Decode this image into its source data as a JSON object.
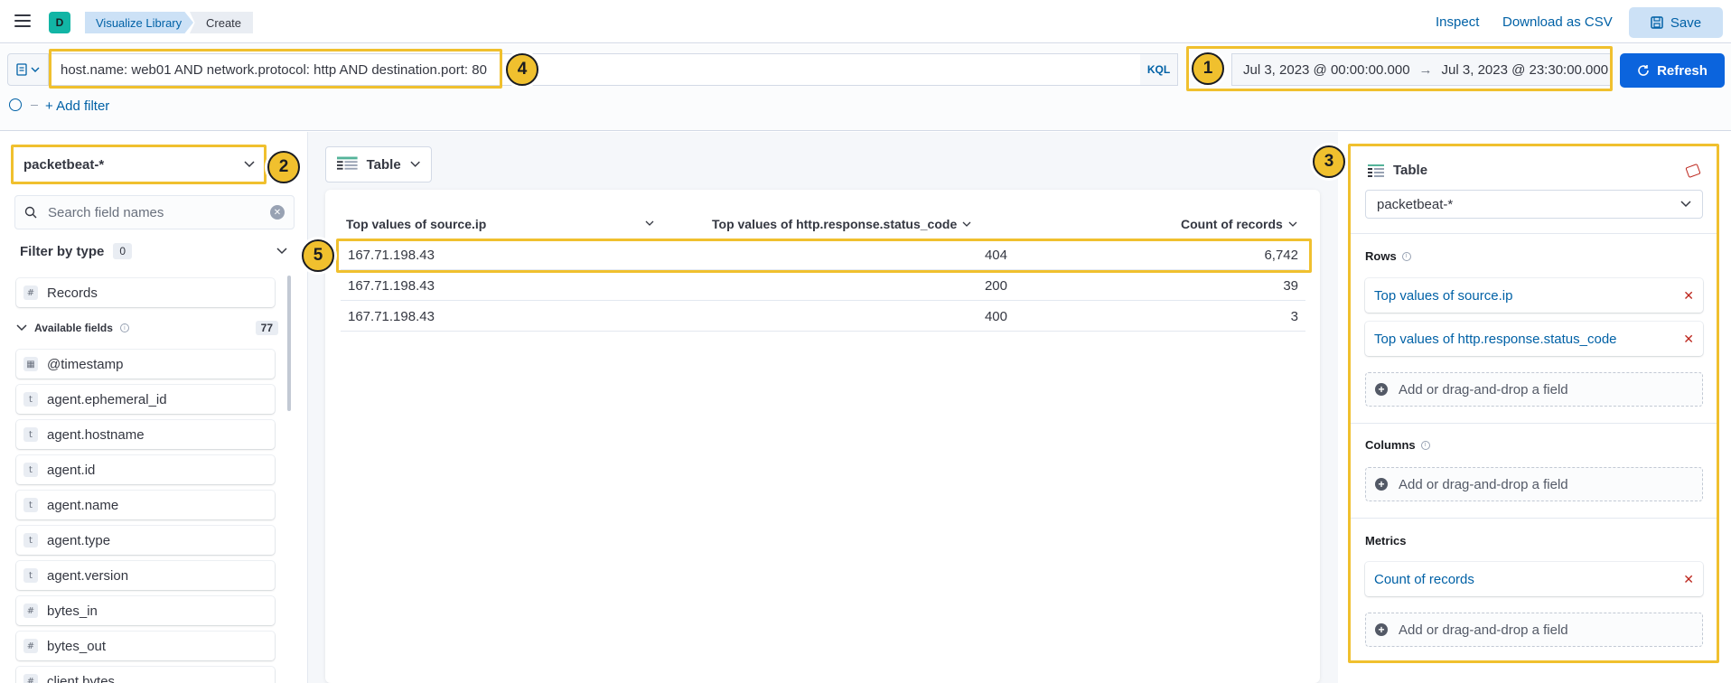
{
  "header": {
    "space_initial": "D",
    "breadcrumbs": [
      "Visualize Library",
      "Create"
    ],
    "inspect": "Inspect",
    "download_csv": "Download as CSV",
    "save": "Save"
  },
  "query": {
    "text": "host.name: web01 AND network.protocol: http AND destination.port: 80",
    "language": "KQL",
    "date_start": "Jul 3, 2023 @ 00:00:00.000",
    "date_arrow": "→",
    "date_end": "Jul 3, 2023 @ 23:30:00.000",
    "refresh": "Refresh",
    "add_filter": "+ Add filter"
  },
  "sidebar": {
    "index_pattern": "packetbeat-*",
    "search_placeholder": "Search field names",
    "filter_by_type": "Filter by type",
    "filter_count": "0",
    "records": "Records",
    "available_label": "Available fields",
    "available_count": "77",
    "fields": [
      {
        "name": "@timestamp",
        "type": "date"
      },
      {
        "name": "agent.ephemeral_id",
        "type": "t"
      },
      {
        "name": "agent.hostname",
        "type": "t"
      },
      {
        "name": "agent.id",
        "type": "t"
      },
      {
        "name": "agent.name",
        "type": "t"
      },
      {
        "name": "agent.type",
        "type": "t"
      },
      {
        "name": "agent.version",
        "type": "t"
      },
      {
        "name": "bytes_in",
        "type": "#"
      },
      {
        "name": "bytes_out",
        "type": "#"
      },
      {
        "name": "client.bytes",
        "type": "#"
      }
    ]
  },
  "workspace": {
    "chart_type": "Table",
    "table": {
      "columns": [
        "Top values of source.ip",
        "Top values of http.response.status_code",
        "Count of records"
      ],
      "rows": [
        [
          "167.71.198.43",
          "404",
          "6,742"
        ],
        [
          "167.71.198.43",
          "200",
          "39"
        ],
        [
          "167.71.198.43",
          "400",
          "3"
        ]
      ]
    }
  },
  "config": {
    "title": "Table",
    "index_pattern": "packetbeat-*",
    "rows_label": "Rows",
    "rows": [
      "Top values of source.ip",
      "Top values of http.response.status_code"
    ],
    "columns_label": "Columns",
    "metrics_label": "Metrics",
    "metrics": [
      "Count of records"
    ],
    "add_field": "Add or drag-and-drop a field"
  },
  "annotations": [
    "1",
    "2",
    "3",
    "4",
    "5"
  ],
  "colors": {
    "primary": "#0b64dd",
    "link": "#0061a6",
    "highlight": "#f0c02e",
    "danger": "#bd271e"
  }
}
